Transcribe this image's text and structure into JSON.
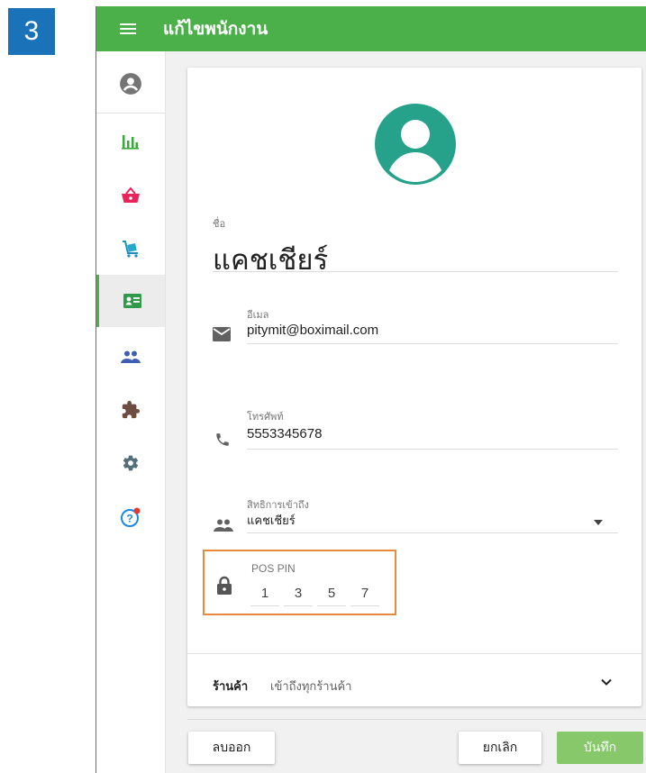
{
  "step_badge": "3",
  "header": {
    "title": "แก้ไขพนักงาน",
    "menu_icon": "hamburger-menu-icon"
  },
  "sidebar": {
    "items": [
      {
        "icon": "account-circle-icon"
      },
      {
        "icon": "bar-chart-icon"
      },
      {
        "icon": "shopping-basket-icon"
      },
      {
        "icon": "inventory-cart-icon"
      },
      {
        "icon": "employee-card-icon",
        "active": true
      },
      {
        "icon": "customers-icon"
      },
      {
        "icon": "integrations-puzzle-icon"
      },
      {
        "icon": "settings-gear-icon"
      },
      {
        "icon": "help-icon"
      }
    ]
  },
  "form": {
    "avatar_icon": "account-circle-icon",
    "name": {
      "label": "ชื่อ",
      "value": "แคชเชียร์"
    },
    "email": {
      "label": "อีเมล",
      "value": "pitymit@boximail.com"
    },
    "phone": {
      "label": "โทรศัพท์",
      "value": "5553345678"
    },
    "role": {
      "label": "สิทธิการเข้าถึง",
      "value": "แคชเชียร์"
    },
    "pin": {
      "label": "POS PIN",
      "digits": [
        "1",
        "3",
        "5",
        "7"
      ]
    },
    "store": {
      "label": "ร้านค้า",
      "value": "เข้าถึงทุกร้านค้า"
    }
  },
  "actions": {
    "delete_label": "ลบออก",
    "cancel_label": "ยกเลิก",
    "save_label": "บันทึก"
  },
  "colors": {
    "header": "#4bb04a",
    "avatar": "#26a18a",
    "highlight": "#e8893c",
    "step_badge": "#1a72b9"
  }
}
